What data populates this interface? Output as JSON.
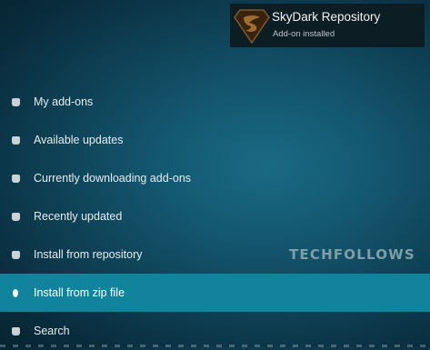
{
  "menu": {
    "items": [
      {
        "label": "My add-ons"
      },
      {
        "label": "Available updates"
      },
      {
        "label": "Currently downloading add-ons"
      },
      {
        "label": "Recently updated"
      },
      {
        "label": "Install from repository"
      },
      {
        "label": "Install from zip file"
      },
      {
        "label": "Search"
      }
    ],
    "selected_index": 5
  },
  "notification": {
    "title": "SkyDark Repository",
    "subtitle": "Add-on installed",
    "icon": "superman-shield-logo"
  },
  "watermark": "TECHFOLLOWS",
  "colors": {
    "background": "#0f4257",
    "selected": "#12839c",
    "toast": "#0d1d24"
  }
}
